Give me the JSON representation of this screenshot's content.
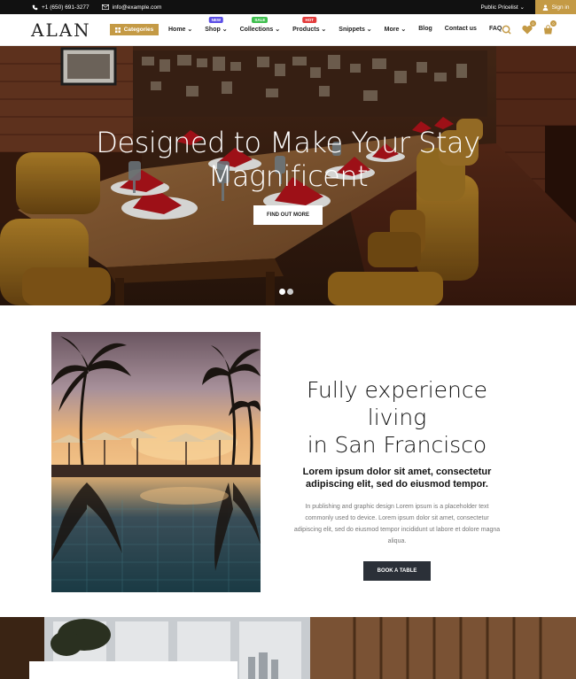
{
  "topbar": {
    "phone": "+1 (650) 691-3277",
    "email": "info@example.com",
    "pricelist": "Public Pricelist",
    "signin": "Sign in"
  },
  "header": {
    "logo": "ALAN",
    "categories_label": "Categories",
    "menu": [
      {
        "label": "Home",
        "dropdown": true
      },
      {
        "label": "Shop",
        "dropdown": true,
        "badge": "NEW",
        "badge_color": "#5b4ee6"
      },
      {
        "label": "Collections",
        "dropdown": true,
        "badge": "SALE",
        "badge_color": "#3fbf4f"
      },
      {
        "label": "Products",
        "dropdown": true,
        "badge": "HOT",
        "badge_color": "#e23b3b"
      },
      {
        "label": "Snippets",
        "dropdown": true
      },
      {
        "label": "More",
        "dropdown": true
      },
      {
        "label": "Blog",
        "dropdown": false
      },
      {
        "label": "Contact us",
        "dropdown": false
      },
      {
        "label": "FAQ",
        "dropdown": false
      }
    ],
    "wishlist_count": "0",
    "cart_count": "0"
  },
  "hero": {
    "title_line1": "Designed to Make Your Stay",
    "title_line2": "Magnificent",
    "button": "FIND OUT MORE",
    "slides": 2,
    "active_slide": 1
  },
  "about": {
    "heading_line1": "Fully experience living",
    "heading_line2": "in San Francisco",
    "sub_line1": "Lorem ipsum dolor sit amet, consectetur",
    "sub_line2": "adipiscing elit, sed do eiusmod tempor.",
    "para_line1": "In publishing and graphic design Lorem ipsum is a placeholder text",
    "para_line2": "commonly used to device. Lorem ipsum dolor sit amet, consectetur",
    "para_line3": "adipiscing elit, sed do eiusmod tempor incididunt ut labore et dolore magna",
    "para_line4": "aliqua.",
    "button": "BOOK A TABLE"
  },
  "colors": {
    "accent": "#c49a45",
    "dark_button": "#2b3038",
    "topbar": "#111111"
  }
}
